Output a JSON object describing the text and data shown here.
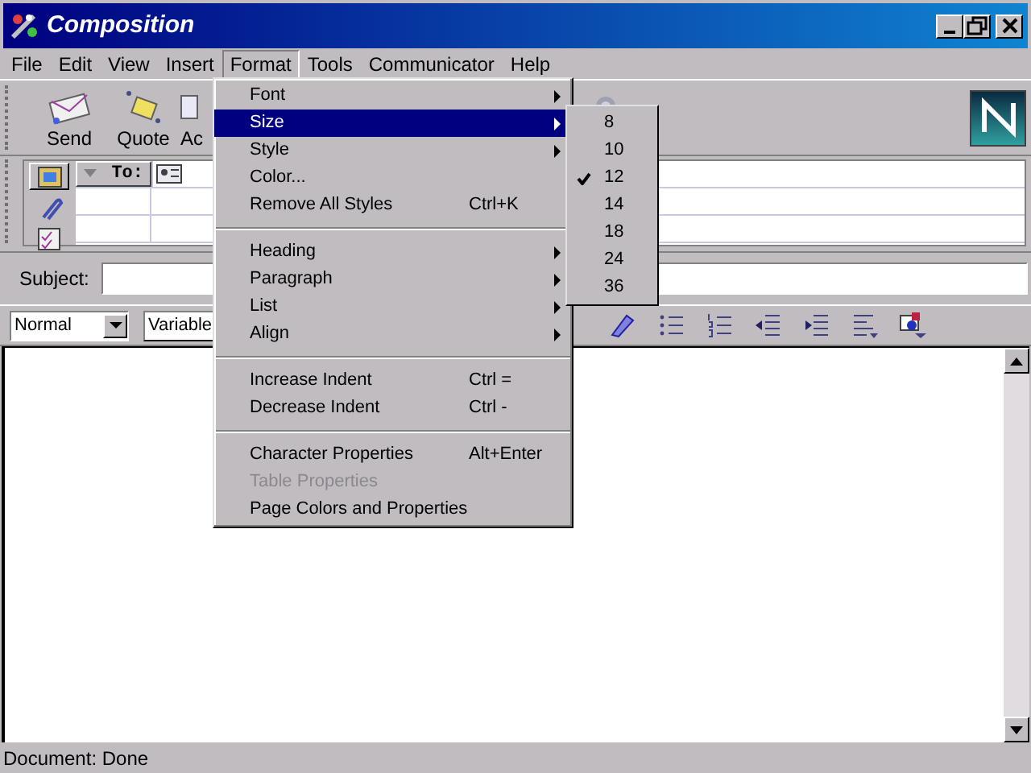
{
  "window": {
    "title": "Composition"
  },
  "menu_bar": [
    {
      "label": "File",
      "selected": false
    },
    {
      "label": "Edit",
      "selected": false
    },
    {
      "label": "View",
      "selected": false
    },
    {
      "label": "Insert",
      "selected": false
    },
    {
      "label": "Format",
      "selected": true
    },
    {
      "label": "Tools",
      "selected": false
    },
    {
      "label": "Communicator",
      "selected": false
    },
    {
      "label": "Help",
      "selected": false
    }
  ],
  "toolbar": [
    {
      "label": "Send",
      "kind": "send"
    },
    {
      "label": "Quote",
      "kind": "quote"
    },
    {
      "label": "Ac",
      "kind": "address"
    }
  ],
  "address": {
    "field_type": "To:",
    "tabs": [
      {
        "selected": true
      },
      {
        "selected": false
      },
      {
        "selected": false
      }
    ]
  },
  "subject": {
    "label": "Subject:"
  },
  "format_bar": {
    "paragraph_style": "Normal",
    "font": "Variable"
  },
  "format_menu": [
    {
      "kind": "item",
      "label": "Font",
      "submenu": true,
      "selected": false,
      "disabled": false
    },
    {
      "kind": "item",
      "label": "Size",
      "submenu": true,
      "selected": true,
      "disabled": false
    },
    {
      "kind": "item",
      "label": "Style",
      "submenu": true,
      "selected": false,
      "disabled": false
    },
    {
      "kind": "item",
      "label": "Color...",
      "submenu": false,
      "selected": false,
      "disabled": false
    },
    {
      "kind": "item",
      "label": "Remove All Styles",
      "shortcut": "Ctrl+K",
      "submenu": false,
      "selected": false,
      "disabled": false
    },
    {
      "kind": "separator"
    },
    {
      "kind": "item",
      "label": "Heading",
      "submenu": true,
      "selected": false,
      "disabled": false
    },
    {
      "kind": "item",
      "label": "Paragraph",
      "submenu": true,
      "selected": false,
      "disabled": false
    },
    {
      "kind": "item",
      "label": "List",
      "submenu": true,
      "selected": false,
      "disabled": false
    },
    {
      "kind": "item",
      "label": "Align",
      "submenu": true,
      "selected": false,
      "disabled": false
    },
    {
      "kind": "separator"
    },
    {
      "kind": "item",
      "label": "Increase Indent",
      "shortcut": "Ctrl =",
      "submenu": false,
      "selected": false,
      "disabled": false
    },
    {
      "kind": "item",
      "label": "Decrease Indent",
      "shortcut": "Ctrl -",
      "submenu": false,
      "selected": false,
      "disabled": false
    },
    {
      "kind": "separator"
    },
    {
      "kind": "item",
      "label": "Character Properties",
      "shortcut": "Alt+Enter",
      "submenu": false,
      "selected": false,
      "disabled": false
    },
    {
      "kind": "item",
      "label": "Table Properties",
      "submenu": false,
      "selected": false,
      "disabled": true
    },
    {
      "kind": "item",
      "label": "Page Colors and Properties",
      "submenu": false,
      "selected": false,
      "disabled": false
    }
  ],
  "size_submenu": [
    {
      "label": "8",
      "checked": false
    },
    {
      "label": "10",
      "checked": false
    },
    {
      "label": "12",
      "checked": true
    },
    {
      "label": "14",
      "checked": false
    },
    {
      "label": "18",
      "checked": false
    },
    {
      "label": "24",
      "checked": false
    },
    {
      "label": "36",
      "checked": false
    }
  ],
  "status_bar": {
    "text": "Document: Done"
  }
}
